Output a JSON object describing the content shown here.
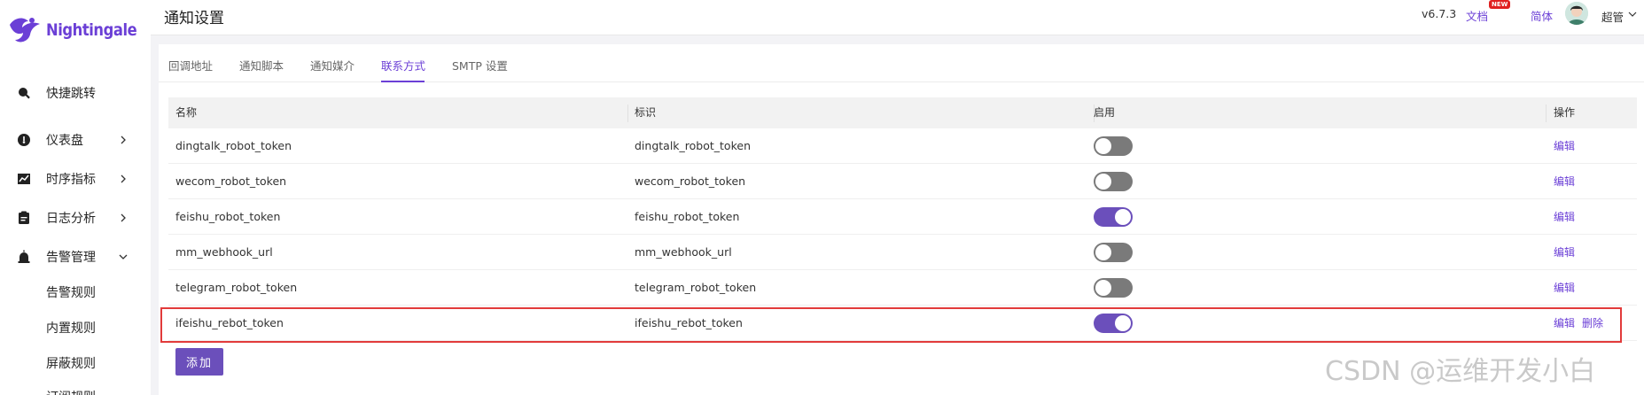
{
  "brand": {
    "name": "Nightingale",
    "color": "#6b3fd6"
  },
  "sidebar": {
    "items": [
      {
        "label": "快捷跳转",
        "icon": "search-icon"
      },
      {
        "label": "仪表盘",
        "icon": "dashboard-icon"
      },
      {
        "label": "时序指标",
        "icon": "line-chart-icon"
      },
      {
        "label": "日志分析",
        "icon": "log-icon"
      },
      {
        "label": "告警管理",
        "icon": "alarm-icon"
      }
    ],
    "sub_items": [
      "告警规则",
      "内置规则",
      "屏蔽规则",
      "订阅规则"
    ]
  },
  "header": {
    "title": "通知设置",
    "version": "v6.7.3",
    "docs": "文档",
    "new_badge": "NEW",
    "language": "简体",
    "user": "超管"
  },
  "tabs": [
    {
      "label": "回调地址",
      "active": false
    },
    {
      "label": "通知脚本",
      "active": false
    },
    {
      "label": "通知媒介",
      "active": false
    },
    {
      "label": "联系方式",
      "active": true
    },
    {
      "label": "SMTP 设置",
      "active": false
    }
  ],
  "table": {
    "columns": [
      "名称",
      "标识",
      "启用",
      "操作"
    ],
    "rows": [
      {
        "name": "dingtalk_robot_token",
        "ident": "dingtalk_robot_token",
        "enabled": false,
        "actions": [
          "编辑"
        ]
      },
      {
        "name": "wecom_robot_token",
        "ident": "wecom_robot_token",
        "enabled": false,
        "actions": [
          "编辑"
        ]
      },
      {
        "name": "feishu_robot_token",
        "ident": "feishu_robot_token",
        "enabled": true,
        "actions": [
          "编辑"
        ]
      },
      {
        "name": "mm_webhook_url",
        "ident": "mm_webhook_url",
        "enabled": false,
        "actions": [
          "编辑"
        ]
      },
      {
        "name": "telegram_robot_token",
        "ident": "telegram_robot_token",
        "enabled": false,
        "actions": [
          "编辑"
        ]
      },
      {
        "name": "ifeishu_rebot_token",
        "ident": "ifeishu_rebot_token",
        "enabled": true,
        "actions": [
          "编辑",
          "删除"
        ]
      }
    ]
  },
  "add_button": "添加",
  "watermark": "CSDN @运维开发小白",
  "colors": {
    "accent": "#6b3fd6",
    "toggle_on": "#6b4fbb",
    "toggle_off": "#7a7a7a",
    "highlight": "#e23b3b"
  }
}
